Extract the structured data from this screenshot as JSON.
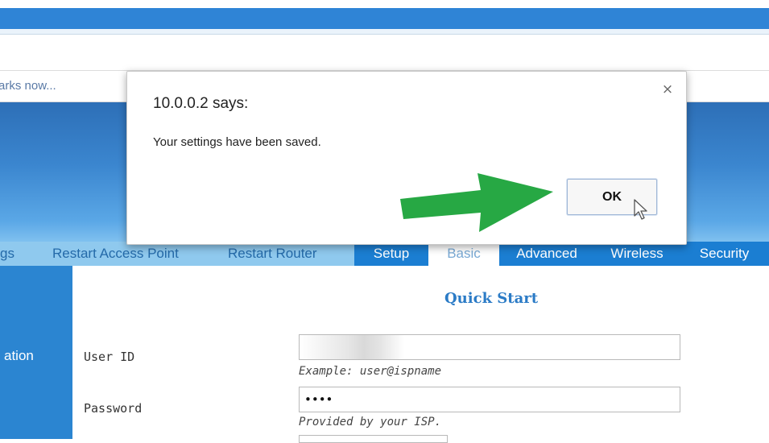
{
  "browser": {
    "bookmarks_text": "arks now..."
  },
  "dialog": {
    "title": "10.0.0.2 says:",
    "message": "Your settings have been saved.",
    "ok_label": "OK",
    "close_icon": "close-icon",
    "close_glyph": "×"
  },
  "nav": {
    "partial_item": "gs",
    "items": [
      "Restart Access Point",
      "Restart Router"
    ],
    "tabs": [
      {
        "label": "Setup",
        "active": false
      },
      {
        "label": "Basic",
        "active": true
      },
      {
        "label": "Advanced",
        "active": false
      },
      {
        "label": "Wireless",
        "active": false
      },
      {
        "label": "Security",
        "active": false
      }
    ]
  },
  "sidebar": {
    "label": "ation"
  },
  "page": {
    "title": "Quick Start",
    "user_id": {
      "label": "User ID",
      "value": "",
      "hint": "Example: user@ispname"
    },
    "password": {
      "label": "Password",
      "value": "••••",
      "hint": "Provided by your ISP."
    }
  },
  "colors": {
    "accent_blue": "#1b7ed2",
    "nav_bg": "#8fc9ee",
    "arrow_green": "#27a844"
  }
}
